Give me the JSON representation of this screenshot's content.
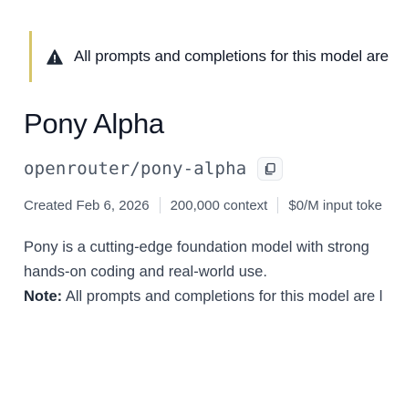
{
  "notice": {
    "icon": "warning-icon",
    "text": "All prompts and completions for this model are",
    "accent_color": "#d6c56a"
  },
  "model": {
    "title": "Pony Alpha",
    "id": "openrouter/pony-alpha",
    "copy_icon": "copy-icon"
  },
  "meta": {
    "created": "Created Feb 6, 2026",
    "context": "200,000 context",
    "pricing": "$0/M input toke"
  },
  "description": {
    "line1": "Pony is a cutting-edge foundation model with strong",
    "line2": "hands-on coding and real-world use.",
    "note_label": "Note:",
    "note_text": " All prompts and completions for this model are l"
  }
}
